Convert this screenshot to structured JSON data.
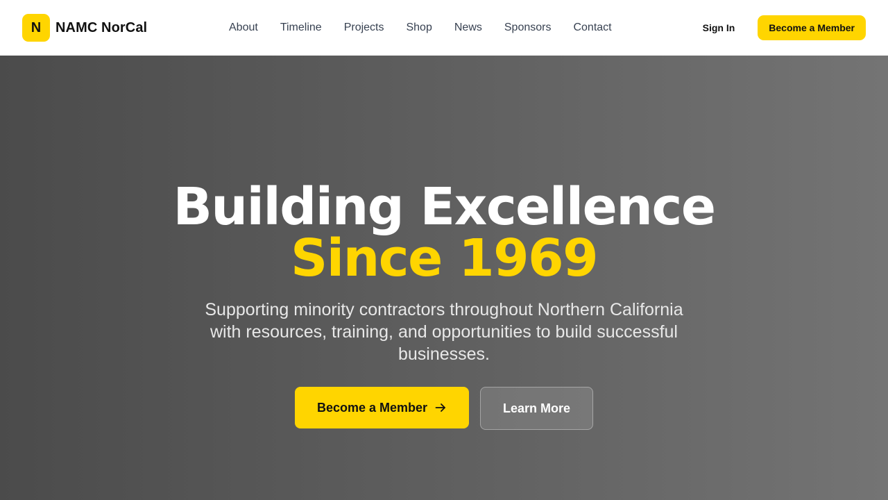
{
  "header": {
    "logo_letter": "N",
    "brand_name": "NAMC NorCal",
    "nav": [
      {
        "label": "About"
      },
      {
        "label": "Timeline"
      },
      {
        "label": "Projects"
      },
      {
        "label": "Shop"
      },
      {
        "label": "News"
      },
      {
        "label": "Sponsors"
      },
      {
        "label": "Contact"
      }
    ],
    "sign_in_label": "Sign In",
    "cta_label": "Become a Member"
  },
  "hero": {
    "headline_line1": "Building Excellence",
    "headline_line2": "Since 1969",
    "subtext": "Supporting minority contractors throughout Northern California with resources, training, and opportunities to build successful businesses.",
    "primary_label": "Become a Member",
    "primary_icon": "arrow-right-icon",
    "secondary_label": "Learn More"
  },
  "colors": {
    "accent": "#FFD500",
    "nav_text": "#374151",
    "hero_bg_start": "#4b4b4b",
    "hero_bg_end": "#747474"
  }
}
